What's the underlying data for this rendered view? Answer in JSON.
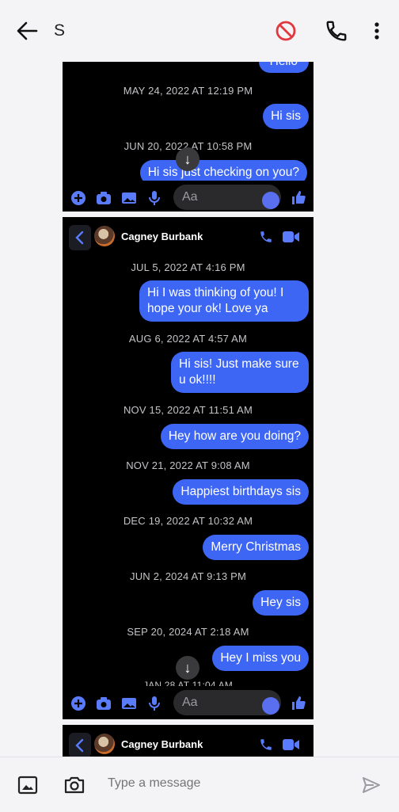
{
  "appbar": {
    "contact_initial": "S"
  },
  "shot1": {
    "partial_bubble": "Hello",
    "messages": [
      {
        "timestamp": "MAY 24, 2022 AT 12:19 PM",
        "text": "Hi sis"
      },
      {
        "timestamp": "JUN 20, 2022 AT 10:58 PM",
        "text": "Hi sis just checking on you?"
      }
    ],
    "composer_placeholder": "Aa"
  },
  "shot2": {
    "contact_name": "Cagney Burbank",
    "messages": [
      {
        "timestamp": "JUL 5, 2022 AT 4:16 PM",
        "text": "Hi  I was thinking of you!  I hope your ok!  Love ya"
      },
      {
        "timestamp": "AUG 6, 2022 AT 4:57 AM",
        "text": "Hi sis! Just make sure u ok!!!!"
      },
      {
        "timestamp": "NOV 15, 2022 AT 11:51 AM",
        "text": "Hey how are you doing?"
      },
      {
        "timestamp": "NOV 21, 2022 AT 9:08 AM",
        "text": "Happiest birthdays sis"
      },
      {
        "timestamp": "DEC 19, 2022 AT 10:32 AM",
        "text": "Merry Christmas"
      },
      {
        "timestamp": "JUN 2, 2024 AT 9:13 PM",
        "text": "Hey sis"
      },
      {
        "timestamp": "SEP 20, 2024 AT 2:18 AM",
        "text": "Hey I miss you"
      }
    ],
    "partial_timestamp": "JAN 28 AT 11:04 AM",
    "composer_placeholder": "Aa"
  },
  "shot3": {
    "contact_name": "Cagney Burbank"
  },
  "bottombar": {
    "placeholder": "Type a message"
  },
  "colors": {
    "bubble": "#3d66f5",
    "block_icon": "#e0383e",
    "messenger_icon": "#5b7cfa"
  },
  "icons": [
    "back-arrow-icon",
    "block-icon",
    "phone-icon",
    "more-vert-icon",
    "scroll-down-arrow-icon",
    "plus-icon",
    "camera-icon",
    "image-icon",
    "mic-icon",
    "emoji-icon",
    "thumbs-up-icon",
    "video-icon",
    "avatar",
    "gallery-icon",
    "send-icon"
  ]
}
